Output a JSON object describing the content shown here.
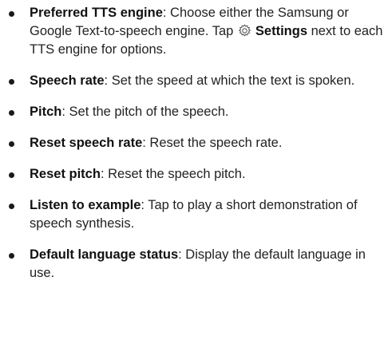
{
  "items": [
    {
      "term": "Preferred TTS engine",
      "text_before": ": Choose either the Samsung or Google Text-to-speech engine. Tap ",
      "icon": "settings-gear-icon",
      "inline_term": "Settings",
      "text_after": " next to each TTS engine for options."
    },
    {
      "term": "Speech rate",
      "text": ": Set the speed at which the text is spoken."
    },
    {
      "term": "Pitch",
      "text": ": Set the pitch of the speech."
    },
    {
      "term": "Reset speech rate",
      "text": ": Reset the speech rate."
    },
    {
      "term": "Reset pitch",
      "text": ": Reset the speech pitch."
    },
    {
      "term": "Listen to example",
      "text": ": Tap to play a short demonstration of speech synthesis."
    },
    {
      "term": "Default language status",
      "text": ": Display the default language in use."
    }
  ]
}
